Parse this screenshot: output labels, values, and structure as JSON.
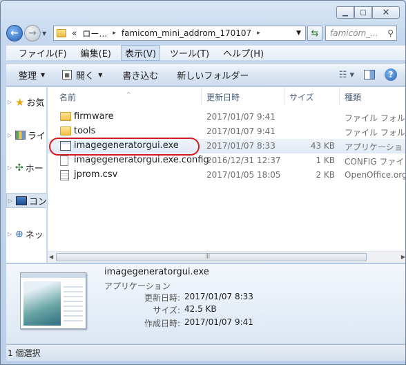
{
  "window": {
    "minimize_glyph": "▁",
    "maximize_glyph": "□",
    "close_glyph": "✕"
  },
  "address": {
    "crumbs": [
      "«",
      "ロー…",
      "famicom_mini_addrom_170107"
    ],
    "search_placeholder": "famicom_..."
  },
  "menu": [
    "ファイル(F)",
    "編集(E)",
    "表示(V)",
    "ツール(T)",
    "ヘルプ(H)"
  ],
  "commands": {
    "organize": "整理",
    "open": "開く",
    "burn": "書き込む",
    "new_folder": "新しいフォルダー"
  },
  "nav_pane": [
    {
      "label": "お気",
      "icon": "star-icon"
    },
    {
      "label": "ライ",
      "icon": "library-icon"
    },
    {
      "label": "ホー",
      "icon": "homegroup-icon"
    },
    {
      "label": "コン",
      "icon": "computer-icon"
    },
    {
      "label": "ネッ",
      "icon": "network-icon"
    }
  ],
  "columns": {
    "name": "名前",
    "date": "更新日時",
    "size": "サイズ",
    "type": "種類"
  },
  "files": [
    {
      "name": "firmware",
      "date": "2017/01/07 9:41",
      "size": "",
      "type": "ファイル フォル",
      "icon": "folder-icon"
    },
    {
      "name": "tools",
      "date": "2017/01/07 9:41",
      "size": "",
      "type": "ファイル フォル",
      "icon": "folder-icon"
    },
    {
      "name": "imagegeneratorgui.exe",
      "date": "2017/01/07 8:33",
      "size": "43 KB",
      "type": "アプリケーショ",
      "icon": "exe-icon"
    },
    {
      "name": "imagegeneratorgui.exe.config",
      "date": "2016/12/31 12:37",
      "size": "1 KB",
      "type": "CONFIG ファイ",
      "icon": "config-file-icon"
    },
    {
      "name": "jprom.csv",
      "date": "2017/01/05 18:05",
      "size": "2 KB",
      "type": "OpenOffice.org",
      "icon": "csv-file-icon"
    }
  ],
  "details": {
    "name": "imagegeneratorgui.exe",
    "type": "アプリケーション",
    "modified_label": "更新日時:",
    "modified_value": "2017/01/07 8:33",
    "size_label": "サイズ:",
    "size_value": "42.5 KB",
    "created_label": "作成日時:",
    "created_value": "2017/01/07 9:41"
  },
  "status": "1 個選択",
  "colors": {
    "highlight_circle": "#d01f1f"
  }
}
